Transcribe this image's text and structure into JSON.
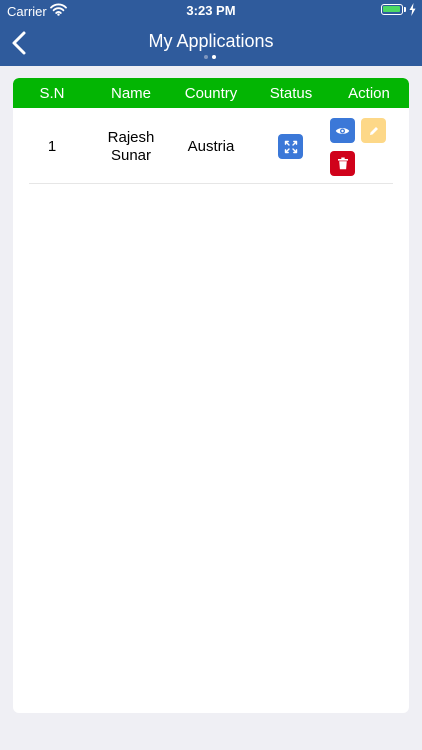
{
  "status_bar": {
    "carrier": "Carrier",
    "time": "3:23 PM"
  },
  "header": {
    "title": "My Applications",
    "back_icon": "chevron-left-icon",
    "background": "#2f5b9c"
  },
  "table": {
    "header_color": "#03b503",
    "columns": [
      "S.N",
      "Name",
      "Country",
      "Status",
      "Action"
    ],
    "rows": [
      {
        "sn": "1",
        "name_line1": "Rajesh",
        "name_line2": "Sunar",
        "country": "Austria",
        "status_icon": "expand-icon",
        "actions": [
          {
            "icon": "eye-icon",
            "color": "#3b78d8"
          },
          {
            "icon": "pencil-icon",
            "color": "#fdd888"
          },
          {
            "icon": "trash-icon",
            "color": "#d0021b"
          }
        ]
      }
    ]
  }
}
